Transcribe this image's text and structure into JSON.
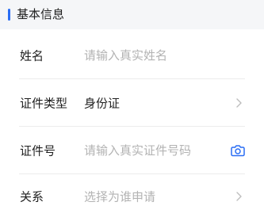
{
  "section": {
    "title": "基本信息"
  },
  "form": {
    "name": {
      "label": "姓名",
      "placeholder": "请输入真实姓名",
      "value": ""
    },
    "id_type": {
      "label": "证件类型",
      "value": "身份证"
    },
    "id_number": {
      "label": "证件号",
      "placeholder": "请输入真实证件号码",
      "value": ""
    },
    "relation": {
      "label": "关系",
      "placeholder": "选择为谁申请"
    }
  },
  "colors": {
    "accent": "#2a6df4",
    "text": "#1f1f1f",
    "placeholder": "#b3b3b3",
    "chevron": "#bdbdbd",
    "background": "#f5f6f8"
  },
  "icons": {
    "id_number_action": "camera-icon",
    "id_type_action": "chevron-right-icon",
    "relation_action": "chevron-right-icon"
  }
}
